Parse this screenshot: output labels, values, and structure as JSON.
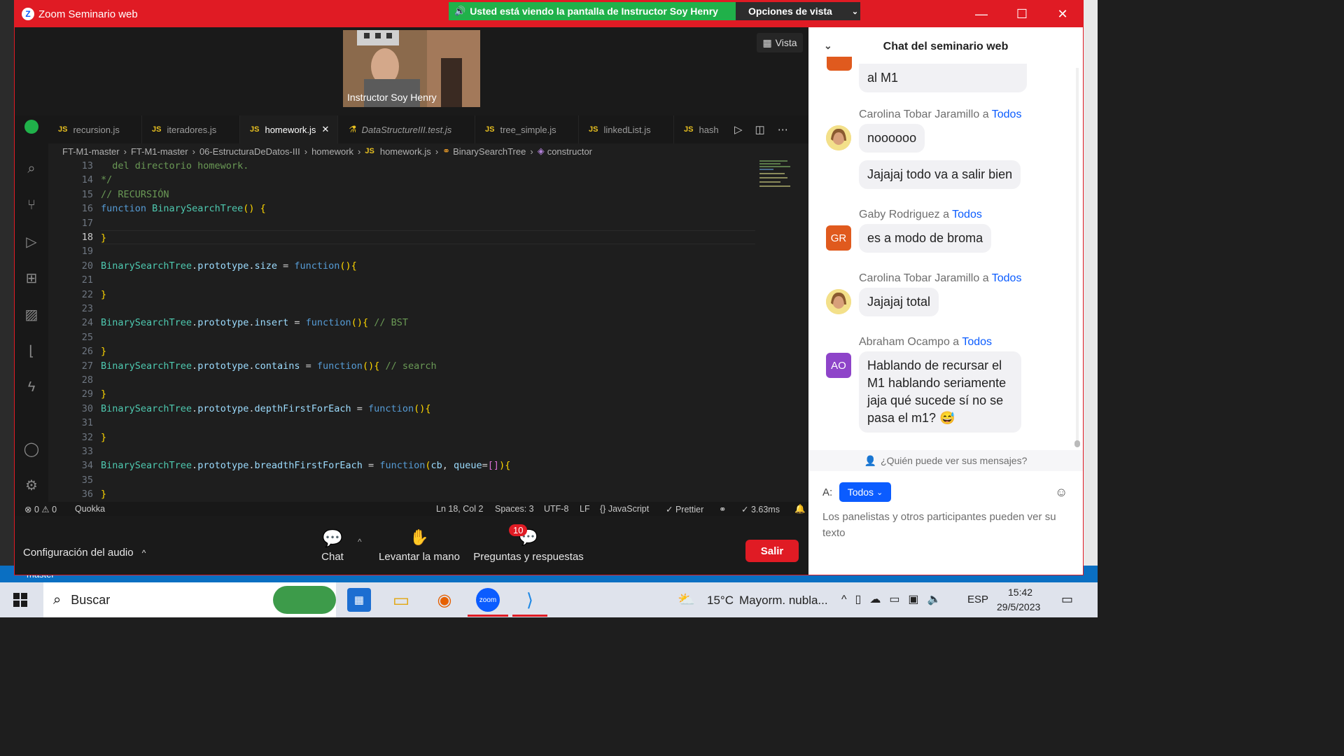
{
  "window": {
    "title": "Zoom Seminario web",
    "viewing_banner": "Usted está viendo la pantalla de Instructor Soy Henry",
    "view_options": "Opciones de vista"
  },
  "video": {
    "name": "Instructor Soy Henry"
  },
  "vista_label": "Vista",
  "editor": {
    "tabs": [
      "recursion.js",
      "iteradores.js",
      "homework.js",
      "DataStructureIII.test.js",
      "tree_simple.js",
      "linkedList.js",
      "hash"
    ],
    "active_tab": "homework.js",
    "breadcrumb": [
      "FT-M1-master",
      "FT-M1-master",
      "06-EstructuraDeDatos-III",
      "homework",
      "homework.js",
      "BinarySearchTree",
      "constructor"
    ],
    "lines": [
      "13",
      "14",
      "15",
      "16",
      "17",
      "18",
      "19",
      "20",
      "21",
      "22",
      "23",
      "24",
      "25",
      "26",
      "27",
      "28",
      "29",
      "30",
      "31",
      "32",
      "33",
      "34",
      "35",
      "36"
    ],
    "status": {
      "problems": "0",
      "warnings": "0",
      "quokka": "Quokka",
      "position": "Ln 18, Col 2",
      "spaces": "Spaces: 3",
      "encoding": "UTF-8",
      "eol": "LF",
      "language": "JavaScript",
      "formatter": "Prettier",
      "timing": "3.63ms"
    }
  },
  "controls": {
    "audio": "Configuración del audio",
    "chat": "Chat",
    "raise_hand": "Levantar la mano",
    "qa": "Preguntas y respuestas",
    "qa_badge": "10",
    "leave": "Salir"
  },
  "chat": {
    "title": "Chat del seminario web",
    "partial_message": "al M1",
    "messages": [
      {
        "sender": "Carolina Tobar Jaramillo",
        "to": "Todos",
        "texts": [
          "noooooo",
          "Jajajaj todo va a salir bien"
        ]
      },
      {
        "sender": "Gaby Rodriguez",
        "to": "Todos",
        "initials": "GR",
        "texts": [
          "es a modo de broma"
        ]
      },
      {
        "sender": "Carolina Tobar Jaramillo",
        "to": "Todos",
        "texts": [
          "Jajajaj total"
        ]
      },
      {
        "sender": "Abraham Ocampo",
        "to": "Todos",
        "initials": "AO",
        "texts": [
          "Hablando de recursar el M1 hablando seriamente jaja qué sucede sí no se pasa el m1? 😅"
        ]
      }
    ],
    "connector": "a",
    "who_can_see": "¿Quién puede ver sus mensajes?",
    "to_label": "A:",
    "to_value": "Todos",
    "placeholder": "Los panelistas y otros participantes pueden ver su texto"
  },
  "background_status": {
    "branch": "master"
  },
  "taskbar": {
    "search": "Buscar",
    "weather": "15°C",
    "weather_desc": "Mayorm. nubla...",
    "lang": "ESP",
    "time": "15:42",
    "date": "29/5/2023"
  },
  "colors": {
    "zoom_red": "#e01b24",
    "zoom_blue": "#0b5cff",
    "green_banner": "#20b14a",
    "vscode_bg": "#1e1e1e"
  }
}
